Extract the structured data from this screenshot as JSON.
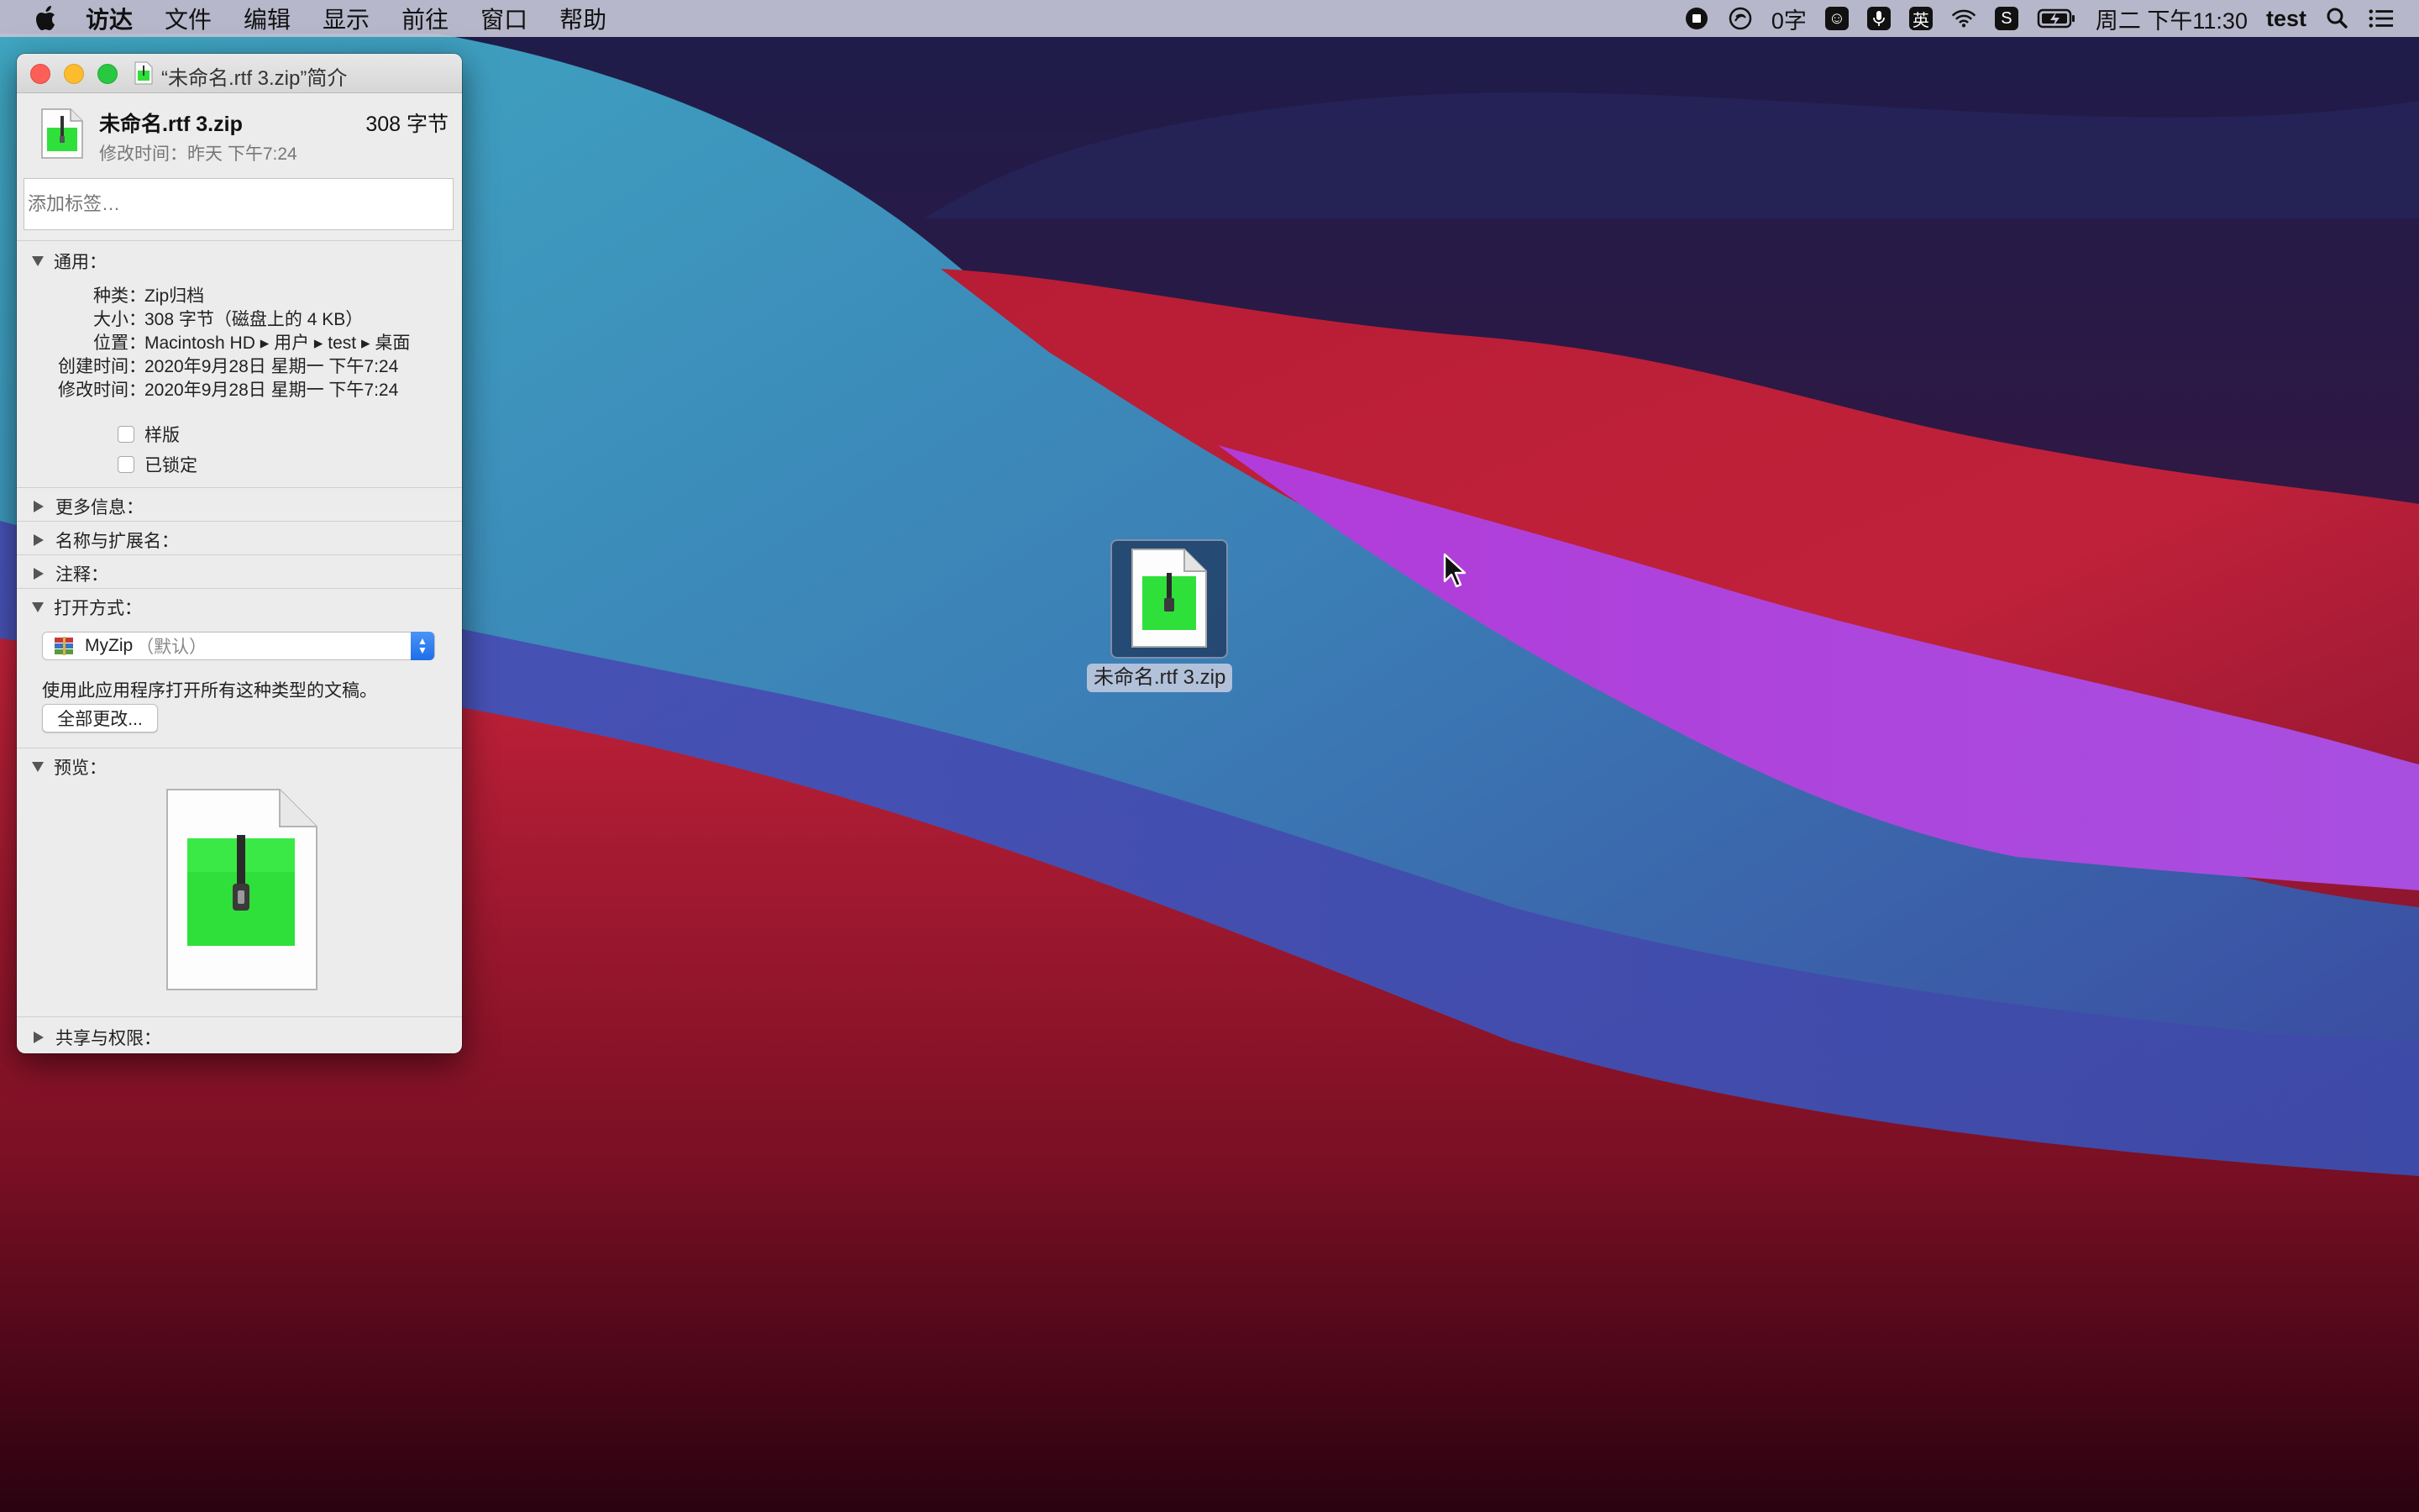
{
  "menubar": {
    "app_menu": "访达",
    "items": [
      "文件",
      "编辑",
      "显示",
      "前往",
      "窗口",
      "帮助"
    ],
    "word_count": "0字",
    "input_method": "英",
    "datetime": "周二 下午11:30",
    "user": "test"
  },
  "info_window": {
    "title": "“未命名.rtf 3.zip”简介",
    "file_name": "未命名.rtf 3.zip",
    "file_size": "308 字节",
    "modified_label": "修改时间：",
    "modified_value": "昨天 下午7:24",
    "tags_placeholder": "添加标签…",
    "general": {
      "header": "通用：",
      "rows": [
        {
          "label": "种类：",
          "value": "Zip归档"
        },
        {
          "label": "大小：",
          "value": "308 字节（磁盘上的 4 KB）"
        },
        {
          "label": "位置：",
          "value": "Macintosh HD ▸ 用户 ▸ test ▸ 桌面"
        },
        {
          "label": "创建时间：",
          "value": "2020年9月28日 星期一 下午7:24"
        },
        {
          "label": "修改时间：",
          "value": "2020年9月28日 星期一 下午7:24"
        }
      ],
      "stationery_label": "样版",
      "locked_label": "已锁定"
    },
    "more_info": "更多信息：",
    "name_ext": "名称与扩展名：",
    "comments": "注释：",
    "open_with": {
      "header": "打开方式：",
      "app_name": "MyZip",
      "app_default": "（默认）",
      "note": "使用此应用程序打开所有这种类型的文稿。",
      "change_all": "全部更改..."
    },
    "preview": "预览：",
    "sharing": "共享与权限："
  },
  "desktop": {
    "file_label": "未命名.rtf 3.zip"
  },
  "colors": {
    "zip_green": "#2fe03a",
    "accent_blue": "#2a78f0"
  }
}
